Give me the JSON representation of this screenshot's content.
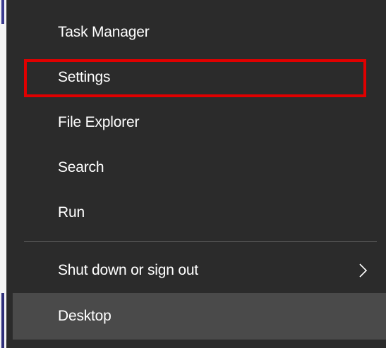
{
  "menu": {
    "items": [
      {
        "id": "task-manager",
        "label": "Task Manager"
      },
      {
        "id": "settings",
        "label": "Settings"
      },
      {
        "id": "file-explorer",
        "label": "File Explorer"
      },
      {
        "id": "search",
        "label": "Search"
      },
      {
        "id": "run",
        "label": "Run"
      }
    ],
    "shutdown": {
      "label": "Shut down or sign out",
      "icon": "chevron-right-icon"
    },
    "desktop": {
      "label": "Desktop"
    }
  },
  "colors": {
    "menu_background": "#2b2b2b",
    "hover_background": "#4a4a4a",
    "text": "#ffffff",
    "separator": "#5c5c5c",
    "highlight_border": "#e00000"
  }
}
